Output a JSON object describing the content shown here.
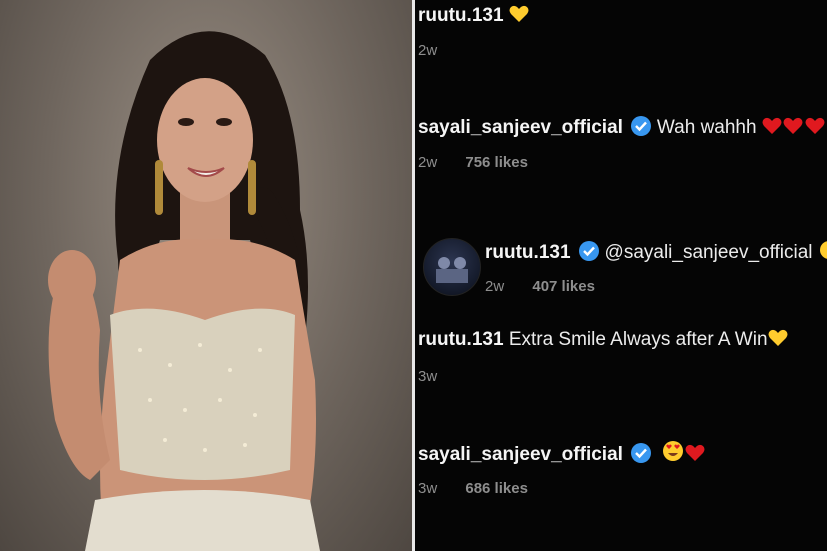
{
  "comments": [
    {
      "user": "ruutu.131",
      "text": "",
      "emojis": [
        "yellow-heart"
      ],
      "verified": false,
      "time": "2w",
      "likes": ""
    },
    {
      "user": "sayali_sanjeev_official",
      "text": "Wah wahhh",
      "emojis": [
        "red-heart",
        "red-heart",
        "red-heart"
      ],
      "verified": true,
      "time": "2w",
      "likes": "756 likes"
    },
    {
      "user": "ruutu.131",
      "text": "@sayali_sanjeev_official",
      "emojis": [
        "smiley-partial"
      ],
      "verified": true,
      "time": "2w",
      "likes": "407 likes",
      "has_avatar": true
    },
    {
      "user": "ruutu.131",
      "text": "Extra Smile Always after A Win",
      "emojis": [
        "yellow-heart"
      ],
      "verified": false,
      "time": "3w",
      "likes": ""
    },
    {
      "user": "sayali_sanjeev_official",
      "text": "",
      "emojis": [
        "heart-eyes-face",
        "red-heart"
      ],
      "verified": true,
      "time": "3w",
      "likes": "686 likes"
    }
  ],
  "colors": {
    "verified": "#3897f0",
    "red_heart": "#e0191f",
    "yellow_heart": "#ffcc2e",
    "meta_gray": "#8e8e8e",
    "background": "#050505"
  }
}
